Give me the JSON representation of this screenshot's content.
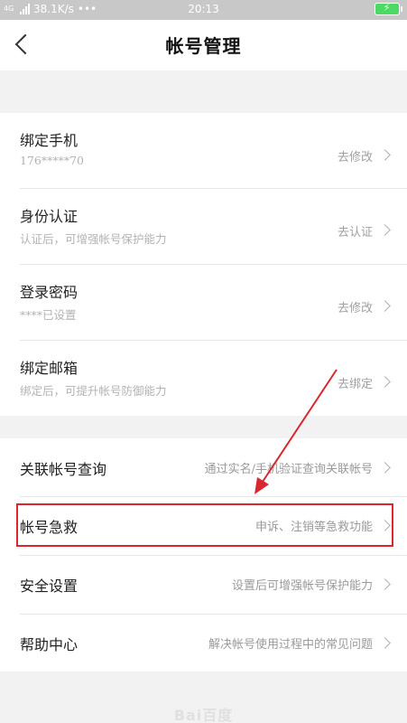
{
  "status_bar": {
    "network_type": "4G",
    "network_speed": "38.1K/s",
    "more": "•••",
    "time": "20:13",
    "battery_icon": "charging-battery-icon"
  },
  "header": {
    "title": "帐号管理",
    "back_icon": "chevron-left-icon"
  },
  "security_items": [
    {
      "title": "绑定手机",
      "subtitle": "176*****70",
      "action": "去修改"
    },
    {
      "title": "身份认证",
      "subtitle": "认证后，可增强帐号保护能力",
      "action": "去认证"
    },
    {
      "title": "登录密码",
      "subtitle": "****已设置",
      "action": "去修改"
    },
    {
      "title": "绑定邮箱",
      "subtitle": "绑定后，可提升帐号防御能力",
      "action": "去绑定"
    }
  ],
  "service_items": [
    {
      "title": "关联帐号查询",
      "desc": "通过实名/手机验证查询关联帐号"
    },
    {
      "title": "帐号急救",
      "desc": "申诉、注销等急救功能"
    },
    {
      "title": "安全设置",
      "desc": "设置后可增强帐号保护能力"
    },
    {
      "title": "帮助中心",
      "desc": "解决帐号使用过程中的常见问题"
    }
  ],
  "annotation": {
    "highlight_color": "#d9262f",
    "highlight_target": "帐号急救"
  },
  "watermark": "Bai百度"
}
